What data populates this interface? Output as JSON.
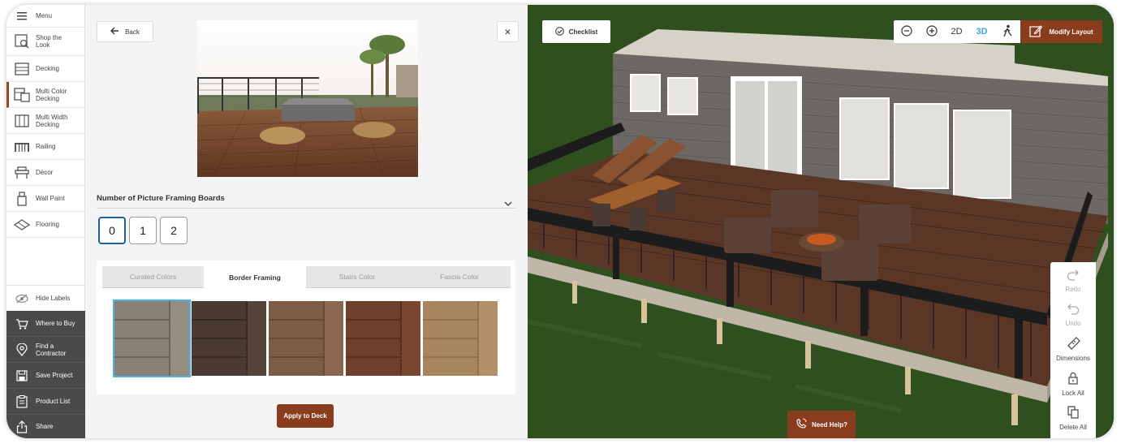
{
  "sidebar": {
    "menu_label": "Menu",
    "items": [
      {
        "label": "Shop the Look",
        "icon": "shop-the-look-icon"
      },
      {
        "label": "Decking",
        "icon": "decking-icon"
      },
      {
        "label": "Multi Color Decking",
        "icon": "multi-color-decking-icon"
      },
      {
        "label": "Multi Width Decking",
        "icon": "multi-width-decking-icon"
      },
      {
        "label": "Railing",
        "icon": "railing-icon"
      },
      {
        "label": "Décor",
        "icon": "decor-icon"
      },
      {
        "label": "Wall Paint",
        "icon": "wall-paint-icon"
      },
      {
        "label": "Flooring",
        "icon": "flooring-icon"
      }
    ],
    "hide_labels": "Hide Labels",
    "actions": [
      {
        "label": "Where to Buy",
        "icon": "cart-icon"
      },
      {
        "label": "Find a Contractor",
        "icon": "location-pin-icon"
      },
      {
        "label": "Save Project",
        "icon": "save-icon"
      },
      {
        "label": "Product List",
        "icon": "clipboard-icon"
      },
      {
        "label": "Share",
        "icon": "share-icon"
      }
    ]
  },
  "panel": {
    "back_label": "Back",
    "close_label": "×",
    "section_title": "Number of Picture Framing Boards",
    "board_options": [
      "0",
      "1",
      "2"
    ],
    "selected_board_option": "0",
    "tabs": [
      "Curated Colors",
      "Border Framing",
      "Stairs Color",
      "Fascia Color"
    ],
    "selected_tab": "Border Framing",
    "swatch_colors": [
      "#8a8076",
      "#4a3a32",
      "#7d5c45",
      "#6e3f2a",
      "#a8855f"
    ],
    "apply_label": "Apply to Deck"
  },
  "view": {
    "checklist_label": "Checklist",
    "toolbar": {
      "zoom_out_icon": "zoom-out-icon",
      "zoom_in_icon": "zoom-in-icon",
      "mode_2d": "2D",
      "mode_3d": "3D",
      "walk_icon": "walk-icon"
    },
    "active_mode": "3D",
    "modify_label": "Modify Layout",
    "right_tools": [
      {
        "label": "Redo",
        "icon": "redo-icon",
        "enabled": false
      },
      {
        "label": "Undo",
        "icon": "undo-icon",
        "enabled": false
      },
      {
        "label": "Dimensions",
        "icon": "ruler-icon",
        "enabled": true
      },
      {
        "label": "Lock All",
        "icon": "lock-icon",
        "enabled": true
      },
      {
        "label": "Delete All",
        "icon": "delete-icon",
        "enabled": true
      }
    ],
    "need_help_label": "Need Help?"
  },
  "colors": {
    "accent_brown": "#8a3d1e",
    "selected_blue": "#1e5ea8",
    "swatch_highlight": "#4ab2e6",
    "sidebar_dark": "#4a4a4a"
  }
}
